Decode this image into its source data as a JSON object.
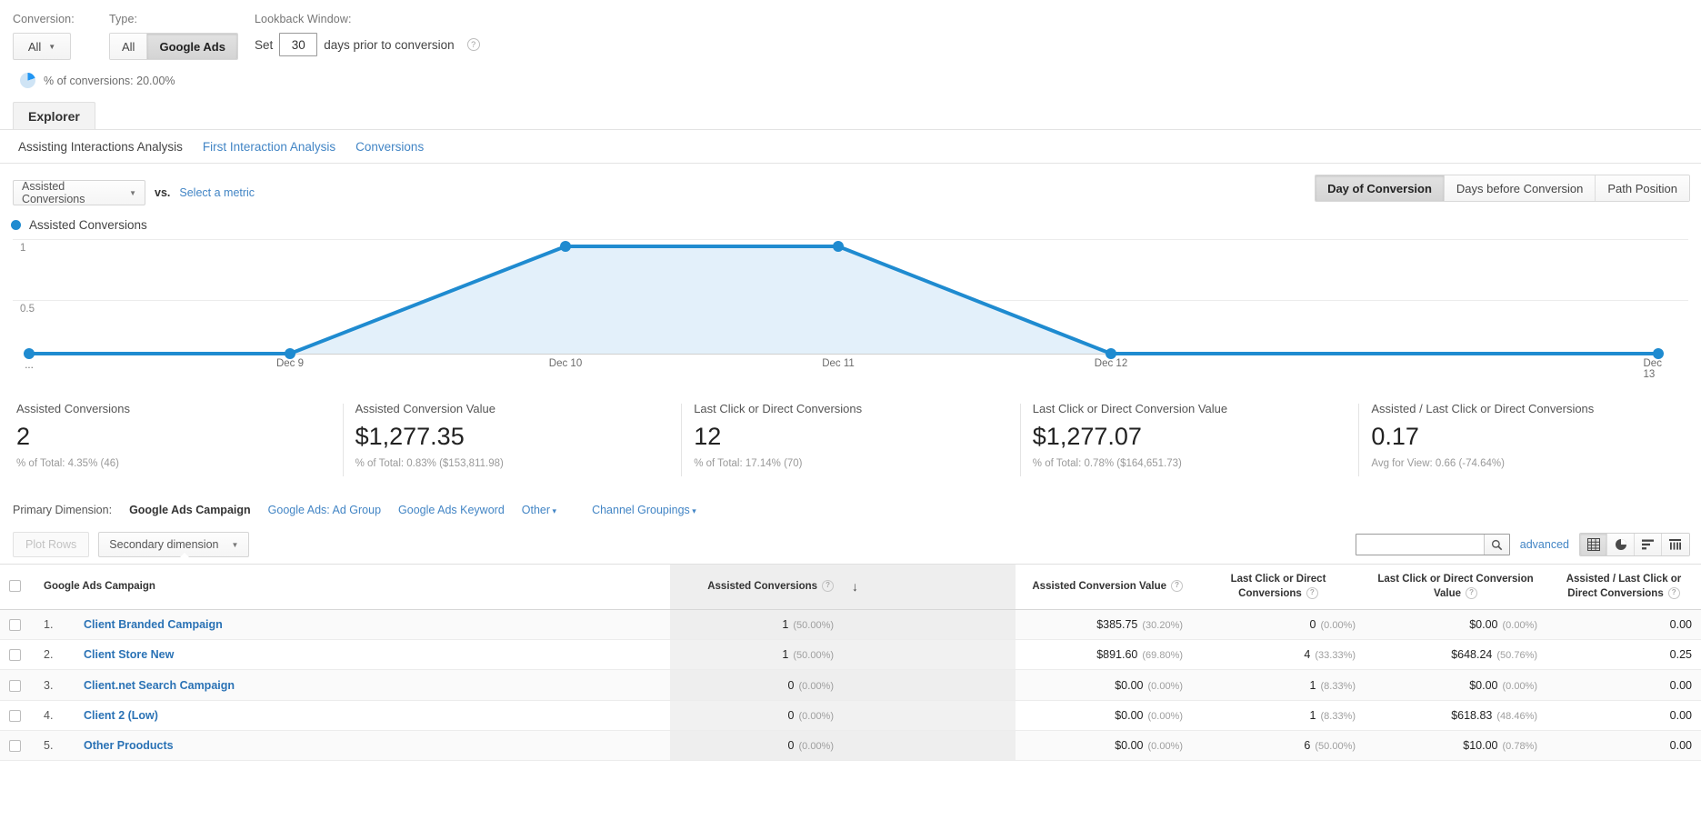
{
  "filters": {
    "conversion_label": "Conversion:",
    "conversion_value": "All",
    "type_label": "Type:",
    "type_options": [
      "All",
      "Google Ads"
    ],
    "type_selected": "Google Ads",
    "lookback_label": "Lookback Window:",
    "lookback_set": "Set",
    "lookback_days": "30",
    "lookback_suffix": "days prior to conversion",
    "conversions_pct": "% of conversions: 20.00%"
  },
  "explorer": {
    "tab_label": "Explorer"
  },
  "subnav": {
    "items": [
      {
        "label": "Assisting Interactions Analysis",
        "current": true
      },
      {
        "label": "First Interaction Analysis",
        "current": false
      },
      {
        "label": "Conversions",
        "current": false
      }
    ]
  },
  "metric_row": {
    "primary_metric": "Assisted Conversions",
    "vs": "vs.",
    "select_metric": "Select a metric",
    "granularity": [
      "Day of Conversion",
      "Days before Conversion",
      "Path Position"
    ],
    "granularity_selected": "Day of Conversion"
  },
  "chart_data": {
    "type": "area",
    "title": "",
    "legend": [
      "Assisted Conversions"
    ],
    "legend_position": "top-left",
    "series": [
      {
        "name": "Assisted Conversions",
        "values": [
          0,
          0,
          1,
          1,
          0,
          0
        ]
      }
    ],
    "categories": [
      "...",
      "Dec 9",
      "Dec 10",
      "Dec 11",
      "Dec 12",
      "Dec 13"
    ],
    "x_tick_labels": [
      "...",
      "Dec 9",
      "Dec 10",
      "Dec 11",
      "Dec 12",
      "Dec 13"
    ],
    "y_tick_labels": [
      "1",
      "0.5"
    ],
    "ylim": [
      0,
      1
    ],
    "grid": true,
    "line_color": "#1f8bd0",
    "fill_color": "#e3f0fa",
    "xlabel": "",
    "ylabel": ""
  },
  "summary_cards": [
    {
      "title": "Assisted Conversions",
      "value": "2",
      "sub": "% of Total: 4.35% (46)"
    },
    {
      "title": "Assisted Conversion Value",
      "value": "$1,277.35",
      "sub": "% of Total: 0.83% ($153,811.98)"
    },
    {
      "title": "Last Click or Direct Conversions",
      "value": "12",
      "sub": "% of Total: 17.14% (70)"
    },
    {
      "title": "Last Click or Direct Conversion Value",
      "value": "$1,277.07",
      "sub": "% of Total: 0.78% ($164,651.73)"
    },
    {
      "title": "Assisted / Last Click or Direct Conversions",
      "value": "0.17",
      "sub": "Avg for View: 0.66 (-74.64%)"
    }
  ],
  "primary_dimension": {
    "label": "Primary Dimension:",
    "selected": "Google Ads Campaign",
    "links": [
      "Google Ads: Ad Group",
      "Google Ads Keyword"
    ],
    "other": "Other",
    "channel_groupings": "Channel Groupings"
  },
  "table_toolbar": {
    "plot_rows": "Plot Rows",
    "secondary_dimension": "Secondary dimension",
    "search_placeholder": "",
    "search_value": "",
    "search_icon": "search-icon",
    "advanced": "advanced",
    "view_icons": [
      "table-view-icon",
      "pie-view-icon",
      "performance-view-icon",
      "pivot-view-icon"
    ],
    "view_selected": "table-view-icon"
  },
  "table": {
    "columns": [
      "Google Ads Campaign",
      "Assisted Conversions",
      "Assisted Conversion Value",
      "Last Click or Direct Conversions",
      "Last Click or Direct Conversion Value",
      "Assisted / Last Click or Direct Conversions"
    ],
    "sorted_column": "Assisted Conversions",
    "sort_direction": "desc",
    "rows": [
      {
        "n": "1.",
        "name": "Client Branded Campaign",
        "ac": "1",
        "ac_pct": "(50.00%)",
        "acv": "$385.75",
        "acv_pct": "(30.20%)",
        "lc": "0",
        "lc_pct": "(0.00%)",
        "lcv": "$0.00",
        "lcv_pct": "(0.00%)",
        "ratio": "0.00"
      },
      {
        "n": "2.",
        "name": "Client Store New",
        "ac": "1",
        "ac_pct": "(50.00%)",
        "acv": "$891.60",
        "acv_pct": "(69.80%)",
        "lc": "4",
        "lc_pct": "(33.33%)",
        "lcv": "$648.24",
        "lcv_pct": "(50.76%)",
        "ratio": "0.25"
      },
      {
        "n": "3.",
        "name": "Client.net Search Campaign",
        "ac": "0",
        "ac_pct": "(0.00%)",
        "acv": "$0.00",
        "acv_pct": "(0.00%)",
        "lc": "1",
        "lc_pct": "(8.33%)",
        "lcv": "$0.00",
        "lcv_pct": "(0.00%)",
        "ratio": "0.00"
      },
      {
        "n": "4.",
        "name": "Client 2 (Low)",
        "ac": "0",
        "ac_pct": "(0.00%)",
        "acv": "$0.00",
        "acv_pct": "(0.00%)",
        "lc": "1",
        "lc_pct": "(8.33%)",
        "lcv": "$618.83",
        "lcv_pct": "(48.46%)",
        "ratio": "0.00"
      },
      {
        "n": "5.",
        "name": "Other Prooducts",
        "ac": "0",
        "ac_pct": "(0.00%)",
        "acv": "$0.00",
        "acv_pct": "(0.00%)",
        "lc": "6",
        "lc_pct": "(50.00%)",
        "lcv": "$10.00",
        "lcv_pct": "(0.78%)",
        "ratio": "0.00"
      }
    ]
  }
}
